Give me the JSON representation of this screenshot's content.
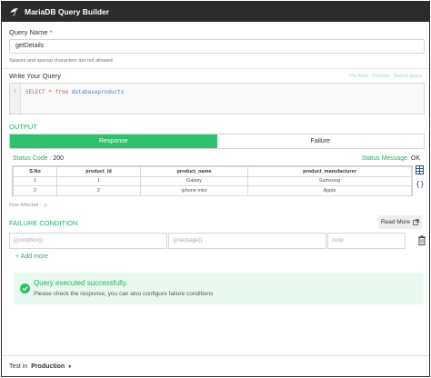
{
  "header": {
    "title": "MariaDB Query Builder",
    "logo_icon": "mariadb-seal-icon"
  },
  "query_name": {
    "label": "Query Name",
    "required_mark": "*",
    "value": "getDetails",
    "hint": "Spaces and special characters are not allowed."
  },
  "write_query": {
    "label": "Write Your Query",
    "links": [
      "Pre Map",
      "Chrome",
      "Tested query"
    ],
    "line_number": "1",
    "code": {
      "keyword": "SELECT * from",
      "table": "databaseproducts"
    }
  },
  "output": {
    "label": "OUTPUT",
    "tabs": [
      {
        "label": "Response",
        "active": true
      },
      {
        "label": "Failure",
        "active": false
      }
    ],
    "status_code_label": "Status Code :",
    "status_code_value": "200",
    "status_message_label": "Status Message:",
    "status_message_value": "OK",
    "table": {
      "columns": [
        "S.No",
        "product_id",
        "product_name",
        "product_manufacturer"
      ],
      "rows": [
        [
          "1",
          "1",
          "Galaxy",
          "Samsung"
        ],
        [
          "2",
          "2",
          "iphone mini",
          "Apple"
        ]
      ]
    },
    "rows_affected": "Row Affected : -|--"
  },
  "failure_condition": {
    "label": "FAILURE CONDITION",
    "read_more": "Read More",
    "placeholders": {
      "condition": "{{condition}}",
      "message": "{{message}}",
      "code": "code"
    },
    "add_more": "+ Add more"
  },
  "success": {
    "title": "Query executed successfully.",
    "detail": "Please check the response, you can also configure failure conditions"
  },
  "footer": {
    "label": "Test in",
    "environment": "Production"
  },
  "colors": {
    "accent": "#2ec06a",
    "header_bg": "#2b2b2b"
  }
}
